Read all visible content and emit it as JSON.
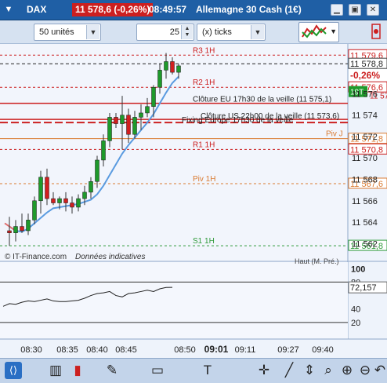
{
  "titlebar": {
    "symbol": "DAX",
    "price": "11 578,6 (-0,26%)",
    "time": "08:49:57",
    "name": "Allemagne 30 Cash (1€)"
  },
  "toolbar": {
    "units": "50 unités",
    "ticks_value": "25",
    "ticks_label": "(x) ticks"
  },
  "price_axis": {
    "ticks": [
      "11 576",
      "11 574",
      "11 572",
      "11 570",
      "11 568",
      "11 566",
      "11 564",
      "11 562"
    ],
    "tags": {
      "r3": "11 579,6",
      "last": "11 578,8",
      "change": "-0,26%",
      "r2": "11 576,6",
      "countdown": "19T",
      "r2b": "11 576,5",
      "piv_j": "11 571,8",
      "r1": "11 570,8",
      "piv": "11 567,6",
      "s1": "11 561,8"
    }
  },
  "levels": {
    "r3": "R3 1H",
    "r2": "R2 1H",
    "cloture_eu": "Clôture EU 17h30 de la veille (11 575,1)",
    "cloture_us": "Clôture US 22h00 de la veille (11 573,6)",
    "fixing": "Fixing Europe 17h30 de la veille",
    "piv_j": "Piv J",
    "r1": "R1 1H",
    "piv": "Piv 1H",
    "s1": "S1 1H"
  },
  "watermark": {
    "source": "© IT-Finance.com",
    "note": "Données indicatives",
    "corner": "Haut (M. Pré.)"
  },
  "oscillator": {
    "ticks": [
      "100",
      "80",
      "40",
      "20"
    ],
    "value": "72,157"
  },
  "time_axis": [
    "08:30",
    "08:35",
    "08:40",
    "08:45",
    "08:50",
    "09:01",
    "09:11",
    "09:27",
    "09:40"
  ],
  "time_axis_bold": "09:01",
  "chart_data": {
    "type": "candlestick",
    "y_range": [
      11561,
      11580.5
    ],
    "candles": [
      {
        "o": 11563.2,
        "h": 11564.5,
        "l": 11561.8,
        "c": 11563.0,
        "up": false
      },
      {
        "o": 11563.0,
        "h": 11564.2,
        "l": 11562.2,
        "c": 11563.6,
        "up": true
      },
      {
        "o": 11563.6,
        "h": 11564.8,
        "l": 11563.0,
        "c": 11563.2,
        "up": false
      },
      {
        "o": 11563.2,
        "h": 11564.8,
        "l": 11562.8,
        "c": 11564.2,
        "up": true
      },
      {
        "o": 11564.2,
        "h": 11566.4,
        "l": 11563.8,
        "c": 11566.0,
        "up": true
      },
      {
        "o": 11566.0,
        "h": 11568.8,
        "l": 11564.8,
        "c": 11568.2,
        "up": true
      },
      {
        "o": 11568.2,
        "h": 11569.0,
        "l": 11565.6,
        "c": 11566.2,
        "up": false
      },
      {
        "o": 11566.2,
        "h": 11566.8,
        "l": 11565.6,
        "c": 11565.8,
        "up": false
      },
      {
        "o": 11565.8,
        "h": 11566.4,
        "l": 11565.2,
        "c": 11566.2,
        "up": true
      },
      {
        "o": 11566.2,
        "h": 11566.8,
        "l": 11565.0,
        "c": 11565.8,
        "up": false
      },
      {
        "o": 11565.8,
        "h": 11566.4,
        "l": 11564.8,
        "c": 11565.4,
        "up": false
      },
      {
        "o": 11565.4,
        "h": 11566.6,
        "l": 11565.0,
        "c": 11566.2,
        "up": true
      },
      {
        "o": 11566.2,
        "h": 11567.4,
        "l": 11565.6,
        "c": 11566.8,
        "up": true
      },
      {
        "o": 11566.8,
        "h": 11568.2,
        "l": 11566.2,
        "c": 11567.8,
        "up": true
      },
      {
        "o": 11567.8,
        "h": 11570.2,
        "l": 11567.2,
        "c": 11569.8,
        "up": true
      },
      {
        "o": 11569.8,
        "h": 11572.2,
        "l": 11569.2,
        "c": 11571.6,
        "up": true
      },
      {
        "o": 11571.6,
        "h": 11574.2,
        "l": 11571.0,
        "c": 11573.8,
        "up": true
      },
      {
        "o": 11573.8,
        "h": 11574.2,
        "l": 11572.8,
        "c": 11573.2,
        "up": false
      },
      {
        "o": 11573.2,
        "h": 11575.8,
        "l": 11570.8,
        "c": 11574.0,
        "up": true
      },
      {
        "o": 11574.0,
        "h": 11574.6,
        "l": 11571.4,
        "c": 11572.2,
        "up": false
      },
      {
        "o": 11572.2,
        "h": 11574.4,
        "l": 11571.8,
        "c": 11573.8,
        "up": true
      },
      {
        "o": 11573.8,
        "h": 11575.0,
        "l": 11572.6,
        "c": 11574.2,
        "up": true
      },
      {
        "o": 11574.2,
        "h": 11575.6,
        "l": 11573.8,
        "c": 11574.8,
        "up": true
      },
      {
        "o": 11574.8,
        "h": 11576.8,
        "l": 11573.8,
        "c": 11576.6,
        "up": true
      },
      {
        "o": 11576.6,
        "h": 11578.8,
        "l": 11576.0,
        "c": 11578.2,
        "up": true
      },
      {
        "o": 11578.2,
        "h": 11579.8,
        "l": 11577.4,
        "c": 11579.0,
        "up": true
      },
      {
        "o": 11579.0,
        "h": 11579.4,
        "l": 11577.8,
        "c": 11578.0,
        "up": false
      },
      {
        "o": 11578.0,
        "h": 11578.8,
        "l": 11577.4,
        "c": 11578.6,
        "up": true
      }
    ],
    "ma": [
      11563.6,
      11563.2,
      11563.1,
      11563.4,
      11563.9,
      11564.4,
      11564.9,
      11565.3,
      11565.4,
      11565.5,
      11565.6,
      11565.7,
      11565.9,
      11566.1,
      11566.6,
      11567.4,
      11568.4,
      11569.4,
      11570.4,
      11571.2,
      11571.9,
      11572.6,
      11573.3,
      11574.1,
      11575.1,
      11576.1,
      11577.0,
      11577.6
    ],
    "oscillator": [
      44,
      48,
      47,
      50,
      52,
      51,
      53,
      55,
      52,
      51,
      51,
      52,
      53,
      56,
      60,
      63,
      64,
      66,
      60,
      58,
      63,
      64,
      66,
      68,
      66,
      70,
      72,
      72.2
    ]
  },
  "colors": {
    "up": "#1e9a2b",
    "down": "#d21f1f",
    "ma": "#5a9be0",
    "level_red": "#cc2020",
    "level_orange": "#d97a30",
    "level_green": "#2f9a3a"
  }
}
